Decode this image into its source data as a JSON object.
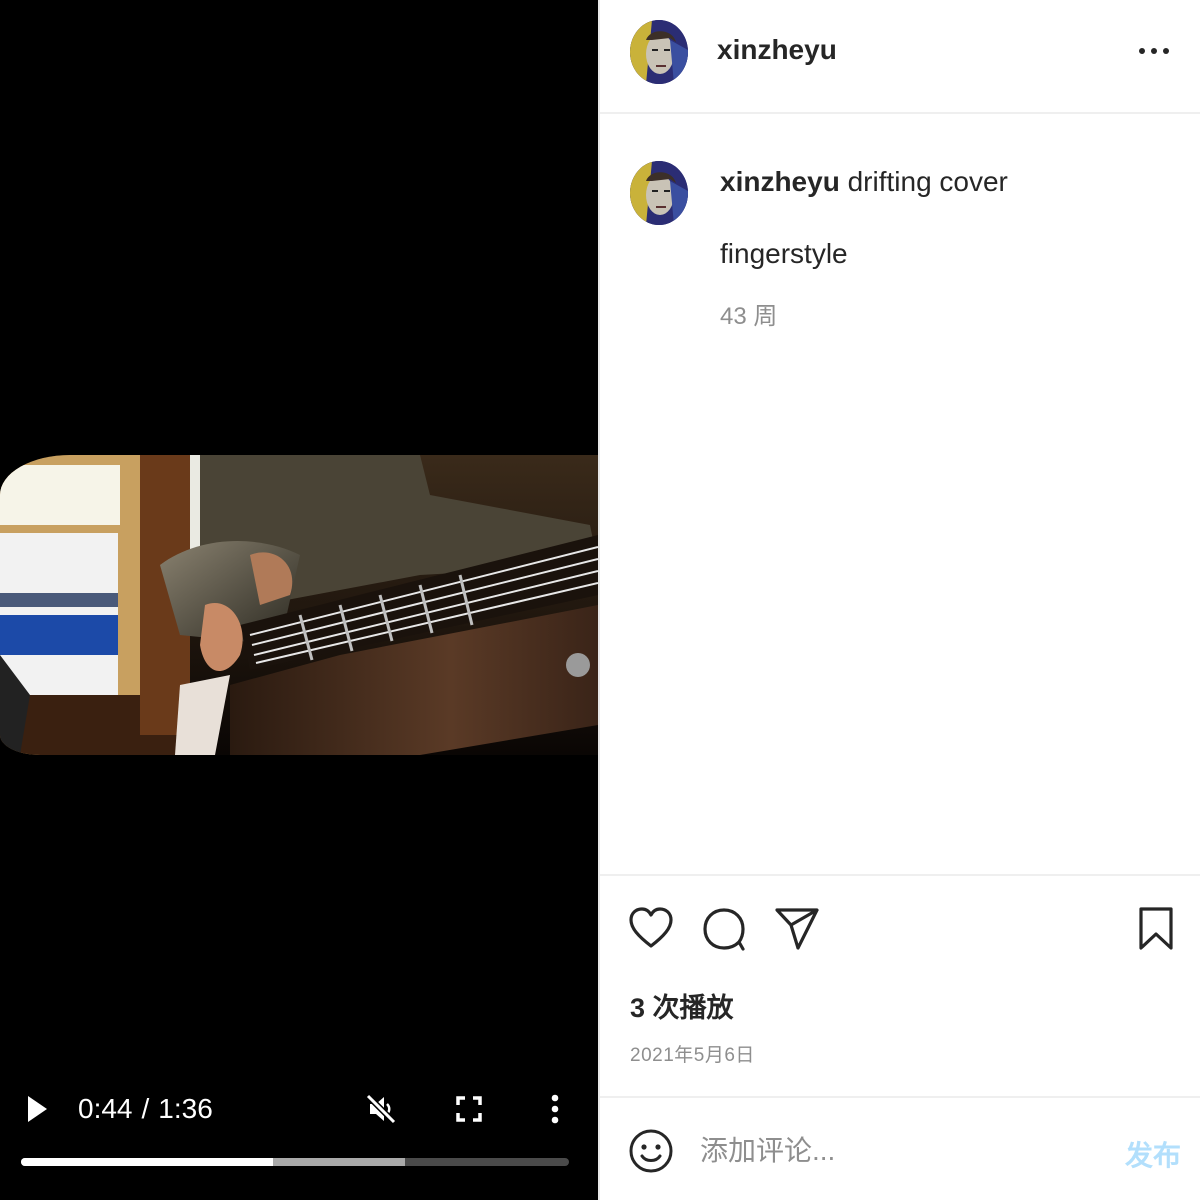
{
  "video": {
    "current_time": "0:44",
    "separator": "/",
    "duration": "1:36",
    "progress_played": 0.46,
    "progress_buffered": 0.7,
    "muted": true,
    "icons": {
      "play": "play-icon",
      "mute": "volume-muted-icon",
      "fullscreen": "fullscreen-icon",
      "more": "more-vertical-icon"
    }
  },
  "header": {
    "username": "xinzheyu",
    "more_icon": "more-horizontal-icon"
  },
  "caption": {
    "username": "xinzheyu",
    "text": "drifting cover",
    "tag_line": "fingerstyle",
    "age": "43 周"
  },
  "actions": {
    "icons": [
      "heart-icon",
      "comment-icon",
      "share-icon",
      "bookmark-icon"
    ],
    "plays": "3 次播放",
    "date": "2021年5月6日"
  },
  "comment": {
    "placeholder": "添加评论...",
    "post_label": "发布",
    "emoji_icon": "emoji-icon"
  },
  "colors": {
    "text": "#262626",
    "muted_text": "#8e8e8e",
    "post_button": "#b2dffc",
    "divider": "#efefef",
    "video_bg": "#000000"
  }
}
